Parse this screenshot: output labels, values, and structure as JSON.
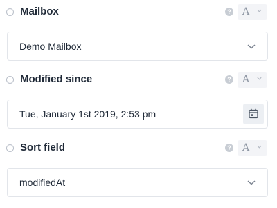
{
  "fields": [
    {
      "label": "Mailbox",
      "mode": "A",
      "value": "Demo Mailbox",
      "control": "select"
    },
    {
      "label": "Modified since",
      "mode": "A",
      "value": "Tue, January 1st 2019, 2:53 pm",
      "control": "datetime"
    },
    {
      "label": "Sort field",
      "mode": "A",
      "value": "modifiedAt",
      "control": "select"
    }
  ],
  "help_glyph": "?",
  "icons": {
    "radio": "radio-circle",
    "help": "question-circle-icon",
    "mode_chevron": "chevron-down-icon",
    "select_chevron": "chevron-down-icon",
    "calendar": "calendar-icon"
  },
  "colors": {
    "label": "#1f2937",
    "border": "#e2e5ea",
    "muted": "#8e96a3",
    "mode_bg": "#f3f4f7"
  }
}
